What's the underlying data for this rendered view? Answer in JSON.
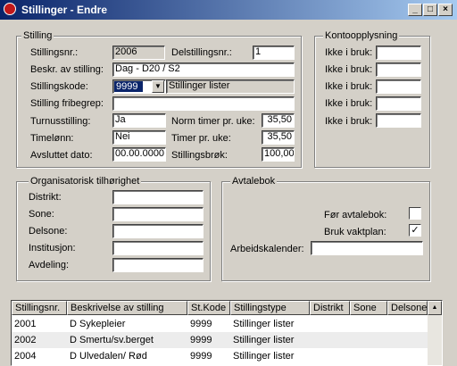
{
  "window": {
    "title": "Stillinger - Endre"
  },
  "stilling": {
    "legend": "Stilling",
    "stillingsnr_label": "Stillingsnr.:",
    "stillingsnr_value": "2006",
    "delstillingsnr_label": "Delstillingsnr.:",
    "delstillingsnr_value": "1",
    "beskr_label": "Beskr. av stilling:",
    "beskr_value": "Dag - D20 / S2",
    "stillingskode_label": "Stillingskode:",
    "stillingskode_value": "9999",
    "stillingskode_text": "Stillinger lister",
    "fribegrep_label": "Stilling fribegrep:",
    "fribegrep_value": "",
    "turnus_label": "Turnusstilling:",
    "turnus_value": "Ja",
    "norm_label": "Norm timer pr. uke:",
    "norm_value": "35,50",
    "timelonn_label": "Timelønn:",
    "timelonn_value": "Nei",
    "timer_label": "Timer pr. uke:",
    "timer_value": "35,50",
    "avsluttet_label": "Avsluttet dato:",
    "avsluttet_value": "00.00.0000",
    "brok_label": "Stillingsbrøk:",
    "brok_value": "100,00"
  },
  "konto": {
    "legend": "Kontoopplysning",
    "items": [
      {
        "label": "Ikke i bruk:",
        "value": ""
      },
      {
        "label": "Ikke i bruk:",
        "value": ""
      },
      {
        "label": "Ikke i bruk:",
        "value": ""
      },
      {
        "label": "Ikke i bruk:",
        "value": ""
      },
      {
        "label": "Ikke i bruk:",
        "value": ""
      }
    ]
  },
  "org": {
    "legend": "Organisatorisk tilhørighet",
    "distrikt_label": "Distrikt:",
    "sone_label": "Sone:",
    "delsone_label": "Delsone:",
    "institusjon_label": "Institusjon:",
    "avdeling_label": "Avdeling:"
  },
  "avtale": {
    "legend": "Avtalebok",
    "for_label": "Før avtalebok:",
    "for_checked": false,
    "bruk_label": "Bruk vaktplan:",
    "bruk_checked": true,
    "bruk_mark": "✓",
    "kalender_label": "Arbeidskalender:",
    "kalender_value": ""
  },
  "table": {
    "columns": [
      "Stillingsnr.",
      "Beskrivelse av stilling",
      "St.Kode",
      "Stillingstype",
      "Distrikt",
      "Sone",
      "Delsone"
    ],
    "rows": [
      [
        "2001",
        "D Sykepleier",
        "9999",
        "Stillinger lister",
        "",
        "",
        ""
      ],
      [
        "2002",
        "D Smertu/sv.berget",
        "9999",
        "Stillinger lister",
        "",
        "",
        ""
      ],
      [
        "2004",
        "D Ulvedalen/ Rød",
        "9999",
        "Stillinger lister",
        "",
        "",
        ""
      ]
    ]
  }
}
